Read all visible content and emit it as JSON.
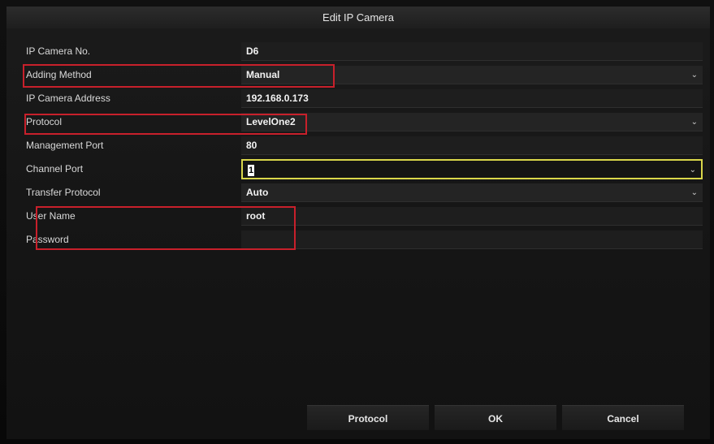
{
  "dialog": {
    "title": "Edit IP Camera"
  },
  "fields": [
    {
      "label": "IP Camera No.",
      "value": "D6",
      "dropdown": false
    },
    {
      "label": "Adding Method",
      "value": "Manual",
      "dropdown": true
    },
    {
      "label": "IP Camera Address",
      "value": "192.168.0.173",
      "dropdown": false
    },
    {
      "label": "Protocol",
      "value": "LevelOne2",
      "dropdown": true
    },
    {
      "label": "Management Port",
      "value": "80",
      "dropdown": false
    },
    {
      "label": "Channel Port",
      "value": "1",
      "dropdown": true,
      "focused": true
    },
    {
      "label": "Transfer Protocol",
      "value": "Auto",
      "dropdown": true
    },
    {
      "label": "User Name",
      "value": "root",
      "dropdown": false
    },
    {
      "label": "Password",
      "value": "",
      "dropdown": false
    }
  ],
  "buttons": {
    "protocol": "Protocol",
    "ok": "OK",
    "cancel": "Cancel"
  },
  "colors": {
    "highlight_red": "#c8202b",
    "focus_yellow": "#d9d64a"
  }
}
